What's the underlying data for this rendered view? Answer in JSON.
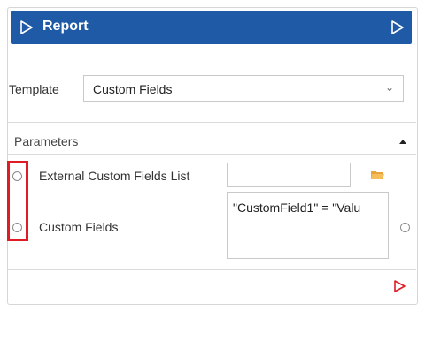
{
  "header": {
    "title": "Report"
  },
  "template": {
    "label": "Template",
    "value": "Custom Fields"
  },
  "parameters": {
    "section_label": "Parameters",
    "rows": [
      {
        "label": "External Custom Fields List",
        "value": ""
      },
      {
        "label": "Custom Fields",
        "value": "\"CustomField1\" = \"Valu"
      }
    ]
  },
  "colors": {
    "header_bg": "#1f5aa6",
    "accent_red": "#e01b24",
    "folder": "#e8a33c"
  }
}
